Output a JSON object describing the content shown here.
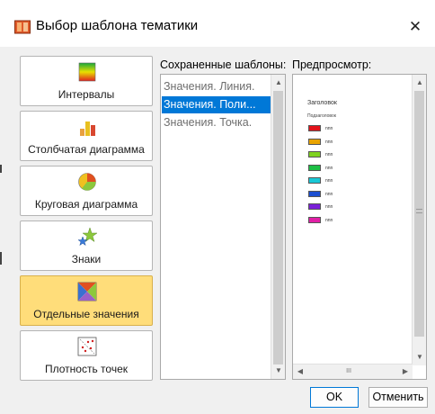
{
  "window": {
    "title": "Выбор шаблона тематики",
    "close_glyph": "✕"
  },
  "categories": [
    {
      "label": "Интервалы",
      "icon": "gradient-icon"
    },
    {
      "label": "Столбчатая диаграмма",
      "icon": "bar-chart-icon"
    },
    {
      "label": "Круговая диаграмма",
      "icon": "pie-chart-icon"
    },
    {
      "label": "Знаки",
      "icon": "stars-icon"
    },
    {
      "label": "Отдельные значения",
      "icon": "unique-values-icon",
      "selected": true
    },
    {
      "label": "Плотность точек",
      "icon": "dot-density-icon"
    }
  ],
  "saved": {
    "label": "Сохраненные шаблоны:",
    "items": [
      "Значения. Линия.",
      "Значения. Поли...",
      "Значения. Точка."
    ],
    "selected_index": 1
  },
  "preview": {
    "label": "Предпросмотр:",
    "title": "Заголовок",
    "subtitle": "Подзаголовок",
    "legend": [
      {
        "color": "#e3131b",
        "label": "nnn"
      },
      {
        "color": "#e9a400",
        "label": "nnn"
      },
      {
        "color": "#7fd320",
        "label": "nnn"
      },
      {
        "color": "#1dbf45",
        "label": "nnn"
      },
      {
        "color": "#19c8d6",
        "label": "nnn"
      },
      {
        "color": "#1c4fd1",
        "label": "nnn"
      },
      {
        "color": "#7a20d8",
        "label": "nnn"
      },
      {
        "color": "#e11fa6",
        "label": "nnn"
      }
    ],
    "hscroll_thumb_glyph": "III"
  },
  "buttons": {
    "ok": "OK",
    "cancel": "Отменить"
  },
  "colors": {
    "selection": "#0078d7",
    "selected_category": "#ffdd7a"
  }
}
